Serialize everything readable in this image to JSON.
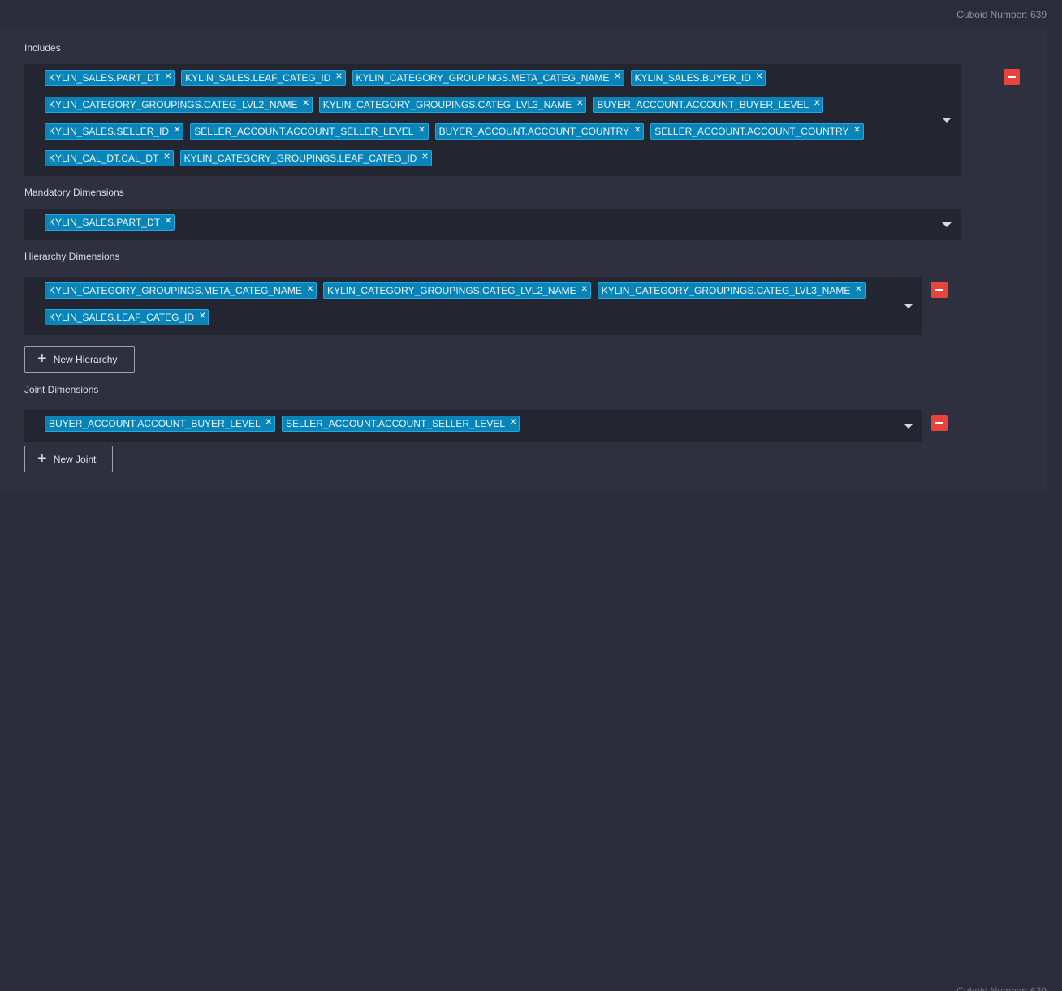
{
  "cuboid_number_text": "Cuboid Number: 639",
  "includes": {
    "label": "Includes",
    "tags": [
      "KYLIN_SALES.PART_DT",
      "KYLIN_SALES.LEAF_CATEG_ID",
      "KYLIN_CATEGORY_GROUPINGS.META_CATEG_NAME",
      "KYLIN_SALES.BUYER_ID",
      "KYLIN_CATEGORY_GROUPINGS.CATEG_LVL2_NAME",
      "KYLIN_CATEGORY_GROUPINGS.CATEG_LVL3_NAME",
      "BUYER_ACCOUNT.ACCOUNT_BUYER_LEVEL",
      "KYLIN_SALES.SELLER_ID",
      "SELLER_ACCOUNT.ACCOUNT_SELLER_LEVEL",
      "BUYER_ACCOUNT.ACCOUNT_COUNTRY",
      "SELLER_ACCOUNT.ACCOUNT_COUNTRY",
      "KYLIN_CAL_DT.CAL_DT",
      "KYLIN_CATEGORY_GROUPINGS.LEAF_CATEG_ID"
    ]
  },
  "mandatory": {
    "label": "Mandatory Dimensions",
    "tags": [
      "KYLIN_SALES.PART_DT"
    ]
  },
  "hierarchy": {
    "label": "Hierarchy Dimensions",
    "tags": [
      "KYLIN_CATEGORY_GROUPINGS.META_CATEG_NAME",
      "KYLIN_CATEGORY_GROUPINGS.CATEG_LVL2_NAME",
      "KYLIN_CATEGORY_GROUPINGS.CATEG_LVL3_NAME",
      "KYLIN_SALES.LEAF_CATEG_ID"
    ],
    "new_button_label": "New Hierarchy"
  },
  "joint": {
    "label": "Joint Dimensions",
    "tags": [
      "BUYER_ACCOUNT.ACCOUNT_BUYER_LEVEL",
      "SELLER_ACCOUNT.ACCOUNT_SELLER_LEVEL"
    ],
    "new_button_label": "New Joint"
  },
  "icons": {
    "tag_remove": "close-icon",
    "dropdown": "caret-down-icon",
    "remove_group": "minus-icon",
    "add": "plus-icon"
  },
  "colors": {
    "tag_bg": "#0884b8",
    "remove_button": "#e7443e",
    "select_bg": "#232531"
  }
}
